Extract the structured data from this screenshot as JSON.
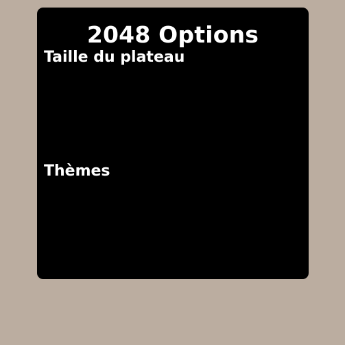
{
  "window": {
    "background_color": "#bbada0"
  },
  "options_panel": {
    "background_color": "#000000",
    "title": "2048 Options",
    "sections": [
      {
        "label": "Taille du plateau"
      },
      {
        "label": "Thèmes"
      }
    ]
  }
}
